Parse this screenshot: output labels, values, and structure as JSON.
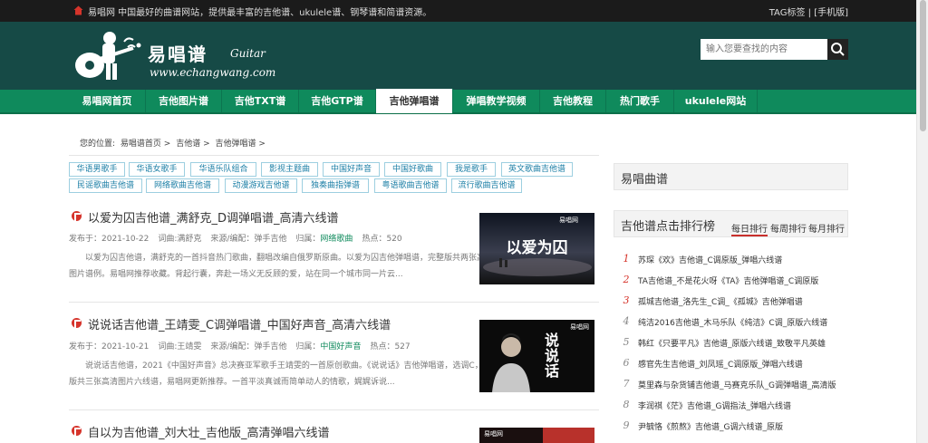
{
  "topbar": {
    "tagline": "易唱网 中国最好的曲谱网站，提供最丰富的吉他谱、ukulele谱、钢琴谱和简谱资源。",
    "right_links": "TAG标签 | [手机版]"
  },
  "logo": {
    "name": "易唱谱",
    "suffix": "Guitar",
    "url": "www.echangwang.com"
  },
  "search": {
    "placeholder": "输入您要查找的内容"
  },
  "nav": {
    "items": [
      {
        "label": "易唱网首页"
      },
      {
        "label": "吉他图片谱"
      },
      {
        "label": "吉他TXT谱"
      },
      {
        "label": "吉他GTP谱"
      },
      {
        "label": "吉他弹唱谱"
      },
      {
        "label": "弹唱教学视频"
      },
      {
        "label": "吉他教程"
      },
      {
        "label": "热门歌手"
      },
      {
        "label": "ukulele网站"
      }
    ],
    "active_index": 4
  },
  "breadcrumb": {
    "prefix": "您的位置:",
    "items": [
      "易唱谱首页 >",
      "吉他谱 >",
      "吉他弹唱谱 >"
    ]
  },
  "tags": [
    "华语男歌手",
    "华语女歌手",
    "华语乐队组合",
    "影视主题曲",
    "中国好声音",
    "中国好歌曲",
    "我是歌手",
    "英文歌曲吉他谱",
    "民谣歌曲吉他谱",
    "网络歌曲吉他谱",
    "动漫游戏吉他谱",
    "独奏曲指弹谱",
    "粤语歌曲吉他谱",
    "流行歌曲吉他谱"
  ],
  "articles": [
    {
      "title": "以爱为囚吉他谱_满舒克_D调弹唱谱_高清六线谱",
      "date": "发布于：2021-10-22",
      "lyricist": "词曲:满舒克",
      "source": "来源/编配：弹手吉他",
      "category_label": "归属：",
      "category": "网络歌曲",
      "hits": "热点：520",
      "excerpt": "以爱为囚吉他谱，满舒克的一首抖音热门歌曲，翻唱改编自俄罗斯原曲。以爱为囚吉他弹唱谱，完整版共两张高清图片谱例。易唱网推荐收藏。背起行囊，奔赴一场义无反顾的爱，站在同一个城市同一片云...",
      "thumb_text": "以爱为囚",
      "thumb_brand": "易唱网"
    },
    {
      "title": "说说话吉他谱_王靖雯_C调弹唱谱_中国好声音_高清六线谱",
      "date": "发布于：2021-10-21",
      "lyricist": "词曲:王靖雯",
      "source": "来源/编配：弹手吉他",
      "category_label": "归属：",
      "category": "中国好声音",
      "hits": "热点：527",
      "excerpt": "说说话吉他谱，2021《中国好声音》总决赛亚军歌手王靖雯的一首原创歌曲。《说说话》吉他弹唱谱，选调C，完整版共三张高清图片六线谱，易唱网更新推荐。一首平淡真诚而简单动人的情歌，娓娓诉说...",
      "thumb_text": "说说话",
      "thumb_brand": "易唱网"
    },
    {
      "title": "自以为吉他谱_刘大壮_吉他版_高清弹唱六线谱",
      "thumb_brand": "易唱网"
    }
  ],
  "sidebar": {
    "box_title": "易唱曲谱",
    "rank_title": "吉他谱点击排行榜",
    "tabs": [
      "每日排行",
      "每周排行",
      "每月排行"
    ],
    "active_tab": 0,
    "ranking": [
      {
        "num": "1",
        "text": "苏琛《欢》吉他谱_C调原版_弹唱六线谱"
      },
      {
        "num": "2",
        "text": "TA吉他谱_不是花火呀《TA》吉他弹唱谱_C调原版"
      },
      {
        "num": "3",
        "text": "孤城吉他谱_洛先生_C调_《孤城》吉他弹唱谱"
      },
      {
        "num": "4",
        "text": "纯洁2016吉他谱_木马乐队《纯洁》C调_原版六线谱"
      },
      {
        "num": "5",
        "text": "韩红《只要平凡》吉他谱_原版六线谱_致敬平凡英雄"
      },
      {
        "num": "6",
        "text": "感官先生吉他谱_刘凤瑶_C调原版_弹唱六线谱"
      },
      {
        "num": "7",
        "text": "莫里森与杂货铺吉他谱_马赛克乐队_G调弹唱谱_高清版"
      },
      {
        "num": "8",
        "text": "李润祺《茫》吉他谱_G调指法_弹唱六线谱"
      },
      {
        "num": "9",
        "text": "尹毓恪《煎熬》吉他谱_G调六线谱_原版"
      }
    ]
  },
  "colors": {
    "topbar_bg": "#1b1b1b",
    "header_bg": "#164a46",
    "nav_bg": "#0f8a5c",
    "rank_top_color": "#d6342b",
    "tag_border": "#9dcfe0",
    "tag_text": "#1c7fa6"
  }
}
